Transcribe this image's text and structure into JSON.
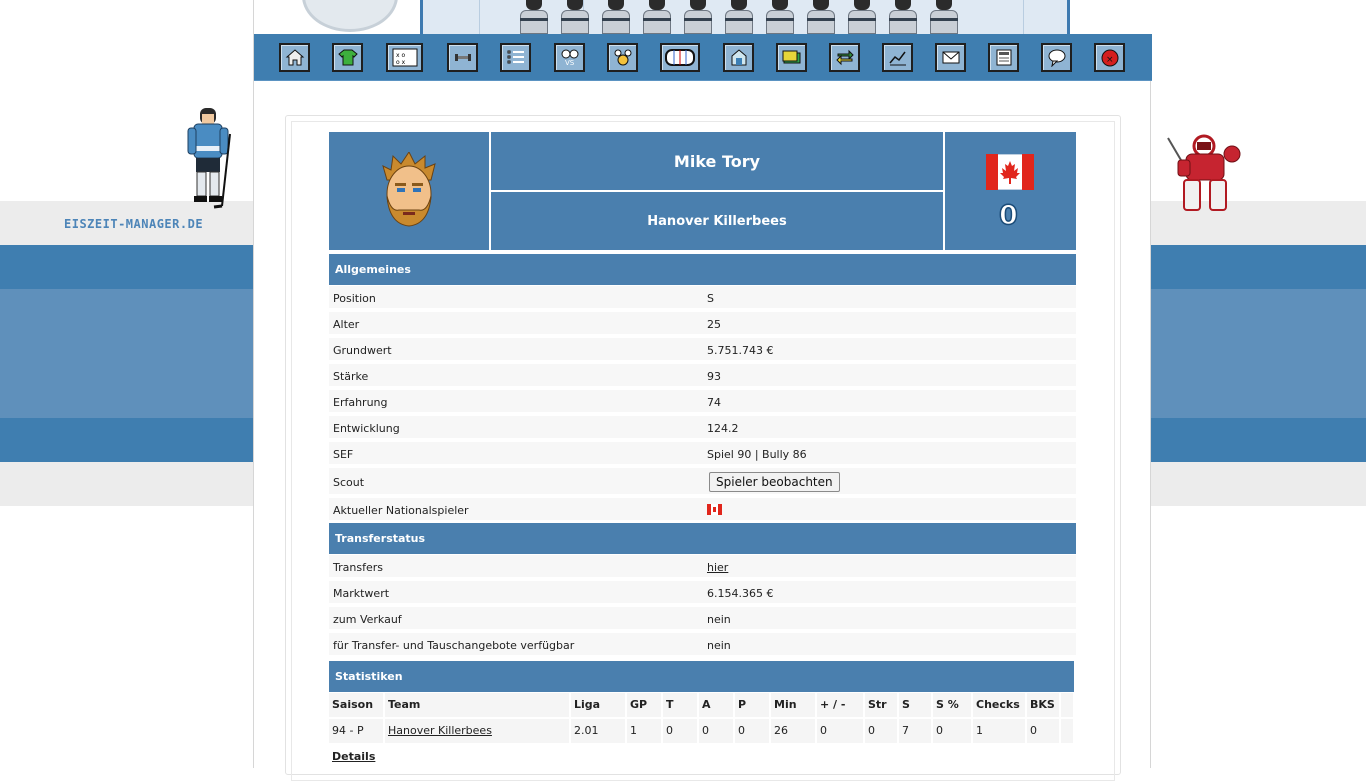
{
  "site": {
    "logo_text": "EISZEIT-MANAGER.DE"
  },
  "nav": {
    "items": [
      {
        "icon": "home-icon"
      },
      {
        "icon": "jersey-icon"
      },
      {
        "icon": "tactics-board-icon"
      },
      {
        "icon": "dumbbell-icon"
      },
      {
        "icon": "list-icon"
      },
      {
        "icon": "versus-icon"
      },
      {
        "icon": "medal-icon"
      },
      {
        "icon": "ice-rink-icon"
      },
      {
        "icon": "arena-icon"
      },
      {
        "icon": "money-icon"
      },
      {
        "icon": "transfer-arrows-icon"
      },
      {
        "icon": "statistics-chart-icon"
      },
      {
        "icon": "mail-icon"
      },
      {
        "icon": "news-icon"
      },
      {
        "icon": "chat-bubble-icon"
      },
      {
        "icon": "logout-icon"
      }
    ],
    "colors": {
      "bar": "#3f7eb0",
      "button": "#8fb4d3"
    }
  },
  "player": {
    "name": "Mike Tory",
    "team": "Hanover Killerbees",
    "number": "0",
    "nation_flag": "canada-flag-icon"
  },
  "general": {
    "title": "Allgemeines",
    "rows": [
      {
        "label": "Position",
        "value": "S"
      },
      {
        "label": "Alter",
        "value": "25"
      },
      {
        "label": "Grundwert",
        "value": "5.751.743 €"
      },
      {
        "label": "Stärke",
        "value": "93"
      },
      {
        "label": "Erfahrung",
        "value": "74"
      },
      {
        "label": "Entwicklung",
        "value": "124.2"
      },
      {
        "label": "SEF",
        "value": "Spiel 90 | Bully 86"
      }
    ],
    "scout_label": "Scout",
    "scout_button": "Spieler beobachten",
    "national_label": "Aktueller Nationalspieler"
  },
  "transfer": {
    "title": "Transferstatus",
    "transfers_label": "Transfers",
    "transfers_link": "hier",
    "rows": [
      {
        "label": "Marktwert",
        "value": "6.154.365 €"
      },
      {
        "label": "zum Verkauf",
        "value": "nein"
      },
      {
        "label": "für Transfer- und Tauschangebote verfügbar",
        "value": "nein"
      }
    ]
  },
  "stats": {
    "title": "Statistiken",
    "headers": [
      "Saison",
      "Team",
      "Liga",
      "GP",
      "T",
      "A",
      "P",
      "Min",
      "+ / -",
      "Str",
      "S",
      "S %",
      "Checks",
      "BKS"
    ],
    "row": [
      "94 - P",
      "Hanover Killerbees",
      "2.01",
      "1",
      "0",
      "0",
      "0",
      "26",
      "0",
      "0",
      "7",
      "0",
      "1",
      "0"
    ],
    "details_link": "Details"
  },
  "colors": {
    "section_header": "#4a7fae",
    "row_bg": "#f7f7f7",
    "accent_blue": "#3f7eb0"
  }
}
